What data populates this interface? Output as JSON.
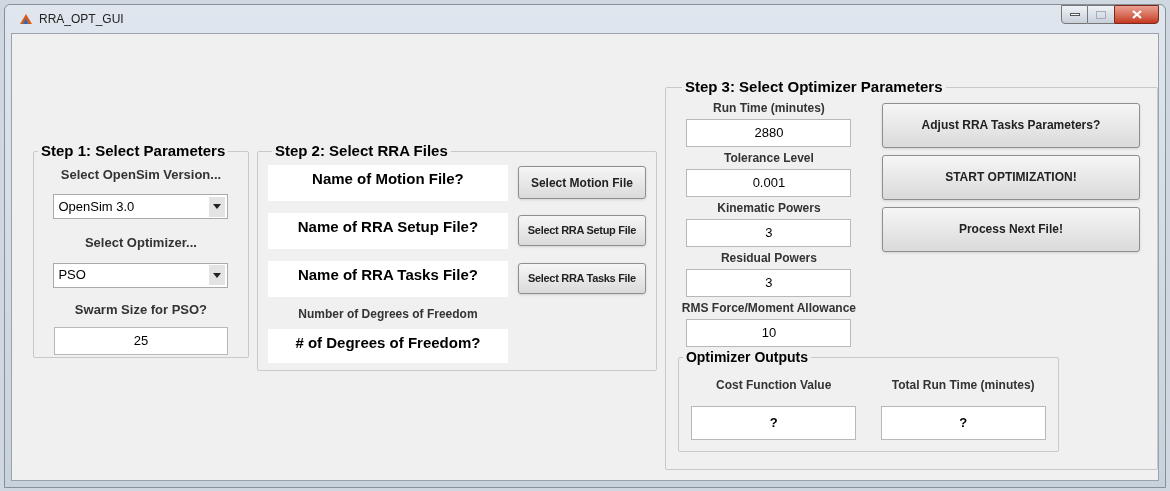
{
  "window": {
    "title": "RRA_OPT_GUI"
  },
  "step1": {
    "title": "Step 1: Select Parameters",
    "version_label": "Select OpenSim Version...",
    "version_dropdown": {
      "value": "OpenSim 3.0"
    },
    "optimizer_label": "Select Optimizer...",
    "optimizer_dropdown": {
      "value": "PSO"
    },
    "swarm_label": "Swarm Size for PSO?",
    "swarm_field": {
      "value": "25"
    }
  },
  "step2": {
    "title": "Step 2: Select RRA Files",
    "files": [
      {
        "name": "Name of Motion File?",
        "button": "Select Motion File"
      },
      {
        "name": "Name of RRA Setup File?",
        "button": "Select RRA Setup File"
      },
      {
        "name": "Name of RRA Tasks File?",
        "button": "Select RRA Tasks File"
      }
    ],
    "dof_label": "Number of Degrees of Freedom",
    "dof_value": "# of Degrees of Freedom?"
  },
  "step3": {
    "title": "Step 3: Select Optimizer Parameters",
    "params": [
      {
        "label": "Run Time (minutes)",
        "value": "2880"
      },
      {
        "label": "Tolerance Level",
        "value": "0.001"
      },
      {
        "label": "Kinematic Powers",
        "value": "3"
      },
      {
        "label": "Residual Powers",
        "value": "3"
      },
      {
        "label": "RMS Force/Moment Allowance",
        "value": "10"
      }
    ],
    "buttons": [
      "Adjust RRA Tasks Parameters?",
      "START OPTIMIZATION!",
      "Process Next File!"
    ],
    "outputs": {
      "title": "Optimizer Outputs",
      "items": [
        {
          "label": "Cost Function Value",
          "value": "?"
        },
        {
          "label": "Total Run Time (minutes)",
          "value": "?"
        }
      ]
    }
  }
}
